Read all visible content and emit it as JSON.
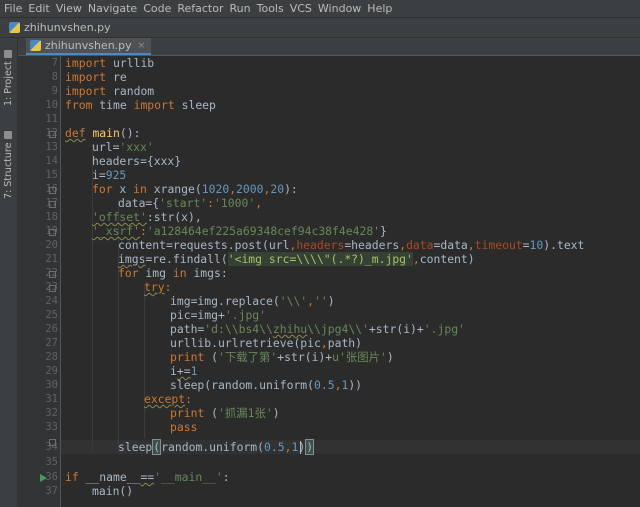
{
  "menu": [
    "File",
    "Edit",
    "View",
    "Navigate",
    "Code",
    "Refactor",
    "Run",
    "Tools",
    "VCS",
    "Window",
    "Help"
  ],
  "breadcrumb": {
    "file": "zhihunvshen.py"
  },
  "sidebar": {
    "project_tab": "1: Project",
    "structure_tab": "7: Structure"
  },
  "editor_tab": {
    "label": "zhihunvshen.py",
    "close": "×"
  },
  "line_numbers": [
    "7",
    "8",
    "9",
    "10",
    "11",
    "12",
    "13",
    "14",
    "15",
    "16",
    "17",
    "18",
    "19",
    "20",
    "21",
    "22",
    "23",
    "24",
    "25",
    "26",
    "27",
    "28",
    "29",
    "30",
    "31",
    "32",
    "33",
    "34",
    "35",
    "36",
    "37"
  ],
  "code": {
    "l7": [
      "import",
      " urllib"
    ],
    "l8": [
      "import",
      " re"
    ],
    "l9": [
      "import",
      " random"
    ],
    "l10": [
      "from",
      " time ",
      "import",
      " sleep"
    ],
    "l12": [
      "def",
      " ",
      "main",
      "():"
    ],
    "l13": [
      "url=",
      "'xxx'"
    ],
    "l14": [
      "headers={xxx}"
    ],
    "l15": [
      "i=",
      "925"
    ],
    "l16": [
      "for",
      " x ",
      "in",
      " xrange(",
      "1020",
      ",",
      "2000",
      ",",
      "20",
      "):"
    ],
    "l17": [
      "data={",
      "'start'",
      ":",
      "'1000'",
      ","
    ],
    "l18": [
      "'offset'",
      ":str(x),"
    ],
    "l19": [
      "'_xsrf'",
      ":",
      "'a128464ef225a69348cef94c38f4e428'",
      "}"
    ],
    "l20": [
      "content=requests.post(url",
      ",",
      "headers",
      "=headers",
      ",",
      "data",
      "=data",
      ",",
      "timeout",
      "=",
      "10",
      ").text"
    ],
    "l21": [
      "imgs",
      "=re.findall(",
      "'<img src=\\\\\\\\\"(.*?)_m.jpg'",
      ",",
      "content)"
    ],
    "l22": [
      "for",
      " img ",
      "in",
      " imgs:"
    ],
    "l23": [
      "try",
      ":"
    ],
    "l24": [
      "img=img.replace(",
      "'\\\\'",
      ",",
      "''",
      ")"
    ],
    "l25": [
      "pic=img+",
      "'.jpg'"
    ],
    "l26": [
      "path=",
      "'d:\\\\bs4\\\\",
      "zhihu",
      "\\\\jpg4\\\\'",
      "+str(i)+",
      "'.jpg'"
    ],
    "l27": [
      "urllib.urlretrieve(pic",
      ",",
      "path)"
    ],
    "l28": [
      "print",
      " (",
      "'下载了第'",
      "+str(i)+",
      "u",
      "'张图片'",
      ")"
    ],
    "l29": [
      "i",
      "+=",
      "1"
    ],
    "l30": [
      "sleep(random.uniform(",
      "0.5",
      ",",
      "1",
      "))"
    ],
    "l31": [
      "except",
      ":"
    ],
    "l32": [
      "print",
      " (",
      "'抓漏1张'",
      ")"
    ],
    "l33": [
      "pass"
    ],
    "l34": [
      "sleep",
      "(",
      "random.uniform(",
      "0.5",
      ",",
      "1",
      ")",
      ")"
    ],
    "l36": [
      "if",
      " __name__",
      "==",
      "'__main__'",
      ":"
    ],
    "l37": [
      "main()"
    ]
  },
  "colors": {
    "background": "#2b2b2b",
    "keyword": "#cc7832",
    "string": "#6a8759",
    "number": "#6897bb",
    "function_def": "#ffc66d",
    "param": "#aa4926",
    "default_text": "#a9b7c6"
  }
}
